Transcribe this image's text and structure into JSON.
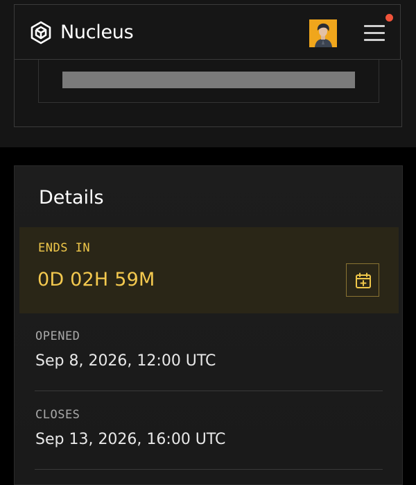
{
  "header": {
    "brand": "Nucleus",
    "logo_icon": "nucleus-cube-icon",
    "avatar_icon": "user-avatar",
    "menu_icon": "hamburger-menu-icon",
    "has_notification": true,
    "notification_color": "#f0533a"
  },
  "details": {
    "title": "Details",
    "ends_in": {
      "label": "ENDS IN",
      "value": "0D 02H 59M",
      "accent_color": "#f0c84a",
      "calendar_icon": "calendar-add-icon"
    },
    "rows": [
      {
        "label": "OPENED",
        "value": "Sep 8, 2026, 12:00 UTC"
      },
      {
        "label": "CLOSES",
        "value": "Sep 13, 2026, 16:00 UTC"
      }
    ]
  }
}
